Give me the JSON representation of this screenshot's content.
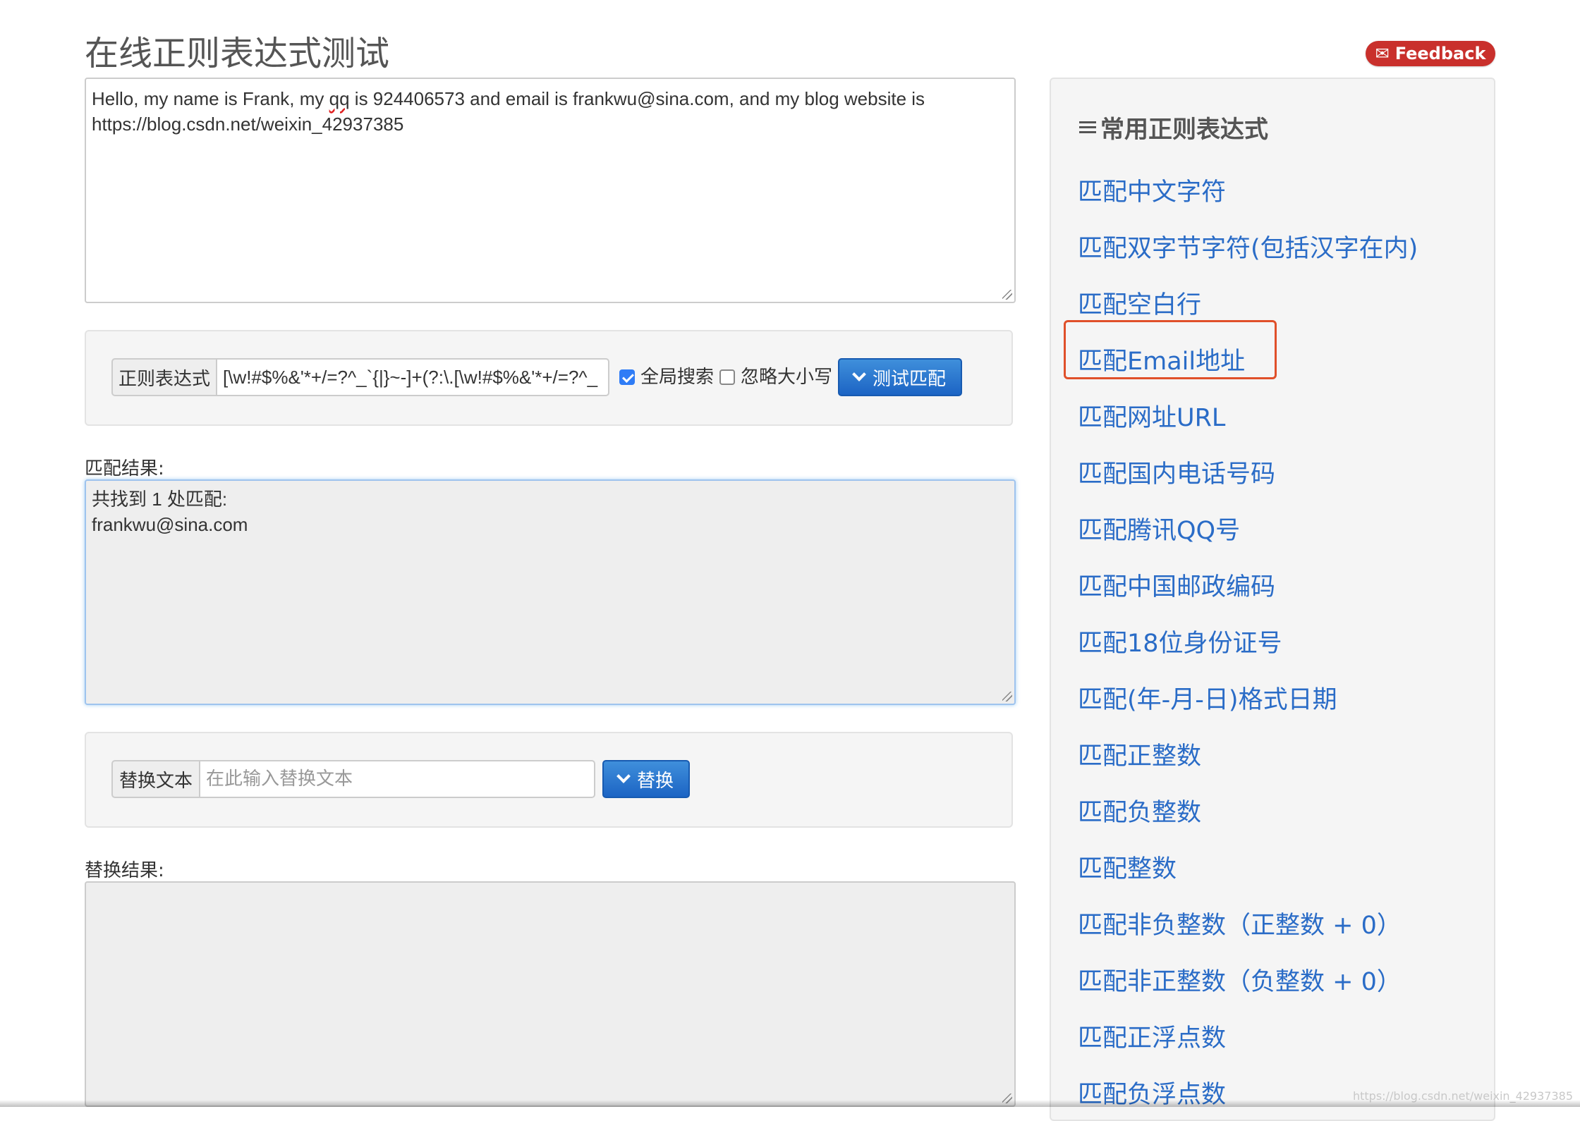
{
  "page": {
    "title": "在线正则表达式测试",
    "feedback_label": "Feedback"
  },
  "source": {
    "line1_before": "Hello, my name is Frank, my ",
    "line1_flagged": "qq",
    "line1_after": " is 924406573 and email is frankwu@sina.com, and my blog website is",
    "line2": "https://blog.csdn.net/weixin_42937385"
  },
  "regex_bar": {
    "addon_label": "正则表达式",
    "pattern": "[\\w!#$%&'*+/=?^_`{|}~-]+(?:\\.[\\w!#$%&'*+/=?^_",
    "global_label": "全局搜索",
    "global_checked": true,
    "ignorecase_label": "忽略大小写",
    "ignorecase_checked": false,
    "test_button": "测试匹配"
  },
  "match_result": {
    "label": "匹配结果:",
    "summary": "共找到 1 处匹配:",
    "matches": [
      "frankwu@sina.com"
    ]
  },
  "replace_bar": {
    "addon_label": "替换文本",
    "placeholder": "在此输入替换文本",
    "value": "",
    "button": "替换"
  },
  "replace_result": {
    "label": "替换结果:",
    "text": ""
  },
  "sidebar": {
    "heading": "常用正则表达式",
    "items": [
      "匹配中文字符",
      "匹配双字节字符(包括汉字在内)",
      "匹配空白行",
      "匹配Email地址",
      "匹配网址URL",
      "匹配国内电话号码",
      "匹配腾讯QQ号",
      "匹配中国邮政编码",
      "匹配18位身份证号",
      "匹配(年-月-日)格式日期",
      "匹配正整数",
      "匹配负整数",
      "匹配整数",
      "匹配非负整数（正整数 + 0）",
      "匹配非正整数（负整数 + 0）",
      "匹配正浮点数",
      "匹配负浮点数"
    ],
    "highlighted_item": "匹配Email地址"
  },
  "watermark": "https://blog.csdn.net/weixin_42937385",
  "colors": {
    "link": "#2a6cc7",
    "primary_button": "#1c64c4",
    "feedback": "#c9302c",
    "highlight": "#e0502a"
  }
}
